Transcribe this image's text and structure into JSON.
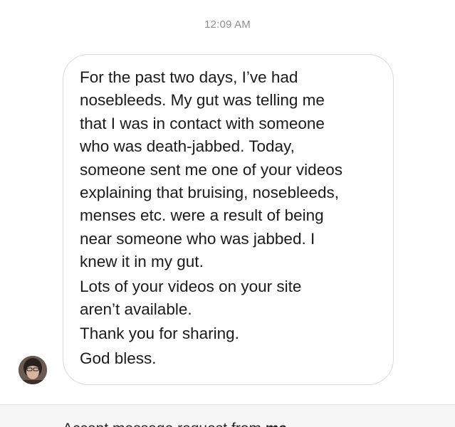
{
  "message": {
    "timestamp": "12:09 AM",
    "paragraphs": [
      "For the past two days, I’ve had\nnosebleeds. My gut was telling me\nthat I was in contact with someone\nwho was death-jabbed. Today,\nsomeone sent me one of your videos\nexplaining that bruising, nosebleeds,\nmenses etc.  were a result of being\nnear someone who was jabbed. I\nknew it in my gut.",
      "Lots of your videos on your site\naren’t available.",
      "Thank you for sharing.",
      "God bless."
    ]
  },
  "sender": {
    "avatar_icon": "user-avatar"
  },
  "footer": {
    "prompt_text": "Accept message request from",
    "prompt_bold": "ma...."
  }
}
